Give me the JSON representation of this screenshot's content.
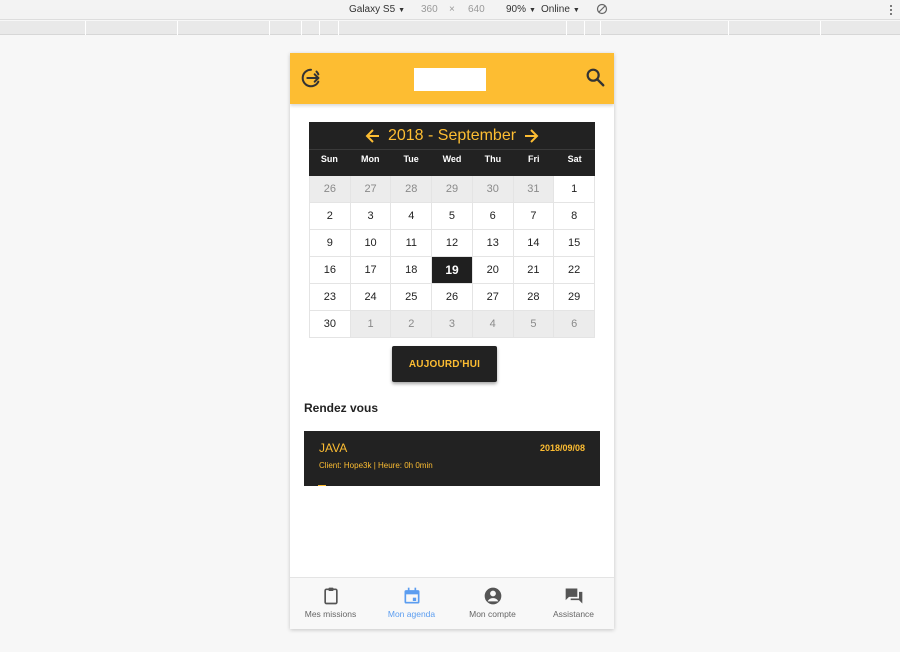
{
  "devtools": {
    "device": "Galaxy S5",
    "width": "360",
    "times": "×",
    "height": "640",
    "zoom": "90%",
    "network": "Online"
  },
  "colors": {
    "accent": "#fdbd32",
    "dark": "#222222",
    "active_nav": "#5b9df0"
  },
  "appbar": {
    "logout_icon": "logout-icon",
    "search_icon": "search-icon"
  },
  "calendar": {
    "year": "2018",
    "separator": "-",
    "month": "September",
    "weekdays": [
      "Sun",
      "Mon",
      "Tue",
      "Wed",
      "Thu",
      "Fri",
      "Sat"
    ],
    "weeks": [
      [
        {
          "d": "26",
          "out": true
        },
        {
          "d": "27",
          "out": true
        },
        {
          "d": "28",
          "out": true
        },
        {
          "d": "29",
          "out": true
        },
        {
          "d": "30",
          "out": true
        },
        {
          "d": "31",
          "out": true
        },
        {
          "d": "1"
        }
      ],
      [
        {
          "d": "2"
        },
        {
          "d": "3"
        },
        {
          "d": "4"
        },
        {
          "d": "5"
        },
        {
          "d": "6"
        },
        {
          "d": "7"
        },
        {
          "d": "8"
        }
      ],
      [
        {
          "d": "9"
        },
        {
          "d": "10"
        },
        {
          "d": "11"
        },
        {
          "d": "12"
        },
        {
          "d": "13"
        },
        {
          "d": "14"
        },
        {
          "d": "15"
        }
      ],
      [
        {
          "d": "16"
        },
        {
          "d": "17"
        },
        {
          "d": "18"
        },
        {
          "d": "19",
          "today": true
        },
        {
          "d": "20"
        },
        {
          "d": "21"
        },
        {
          "d": "22"
        }
      ],
      [
        {
          "d": "23"
        },
        {
          "d": "24"
        },
        {
          "d": "25"
        },
        {
          "d": "26"
        },
        {
          "d": "27"
        },
        {
          "d": "28"
        },
        {
          "d": "29"
        }
      ],
      [
        {
          "d": "30"
        },
        {
          "d": "1",
          "out": true
        },
        {
          "d": "2",
          "out": true
        },
        {
          "d": "3",
          "out": true
        },
        {
          "d": "4",
          "out": true
        },
        {
          "d": "5",
          "out": true
        },
        {
          "d": "6",
          "out": true
        }
      ]
    ]
  },
  "today_button": "AUJOURD'HUI",
  "section_title": "Rendez vous",
  "appointment": {
    "name": "JAVA",
    "date": "2018/09/08",
    "meta": "Client: Hope3k | Heure: 0h 0min"
  },
  "bottom_nav": [
    {
      "label": "Mes missions",
      "icon": "clipboard-icon"
    },
    {
      "label": "Mon agenda",
      "icon": "calendar-icon",
      "active": true
    },
    {
      "label": "Mon compte",
      "icon": "account-icon"
    },
    {
      "label": "Assistance",
      "icon": "chat-icon"
    }
  ]
}
